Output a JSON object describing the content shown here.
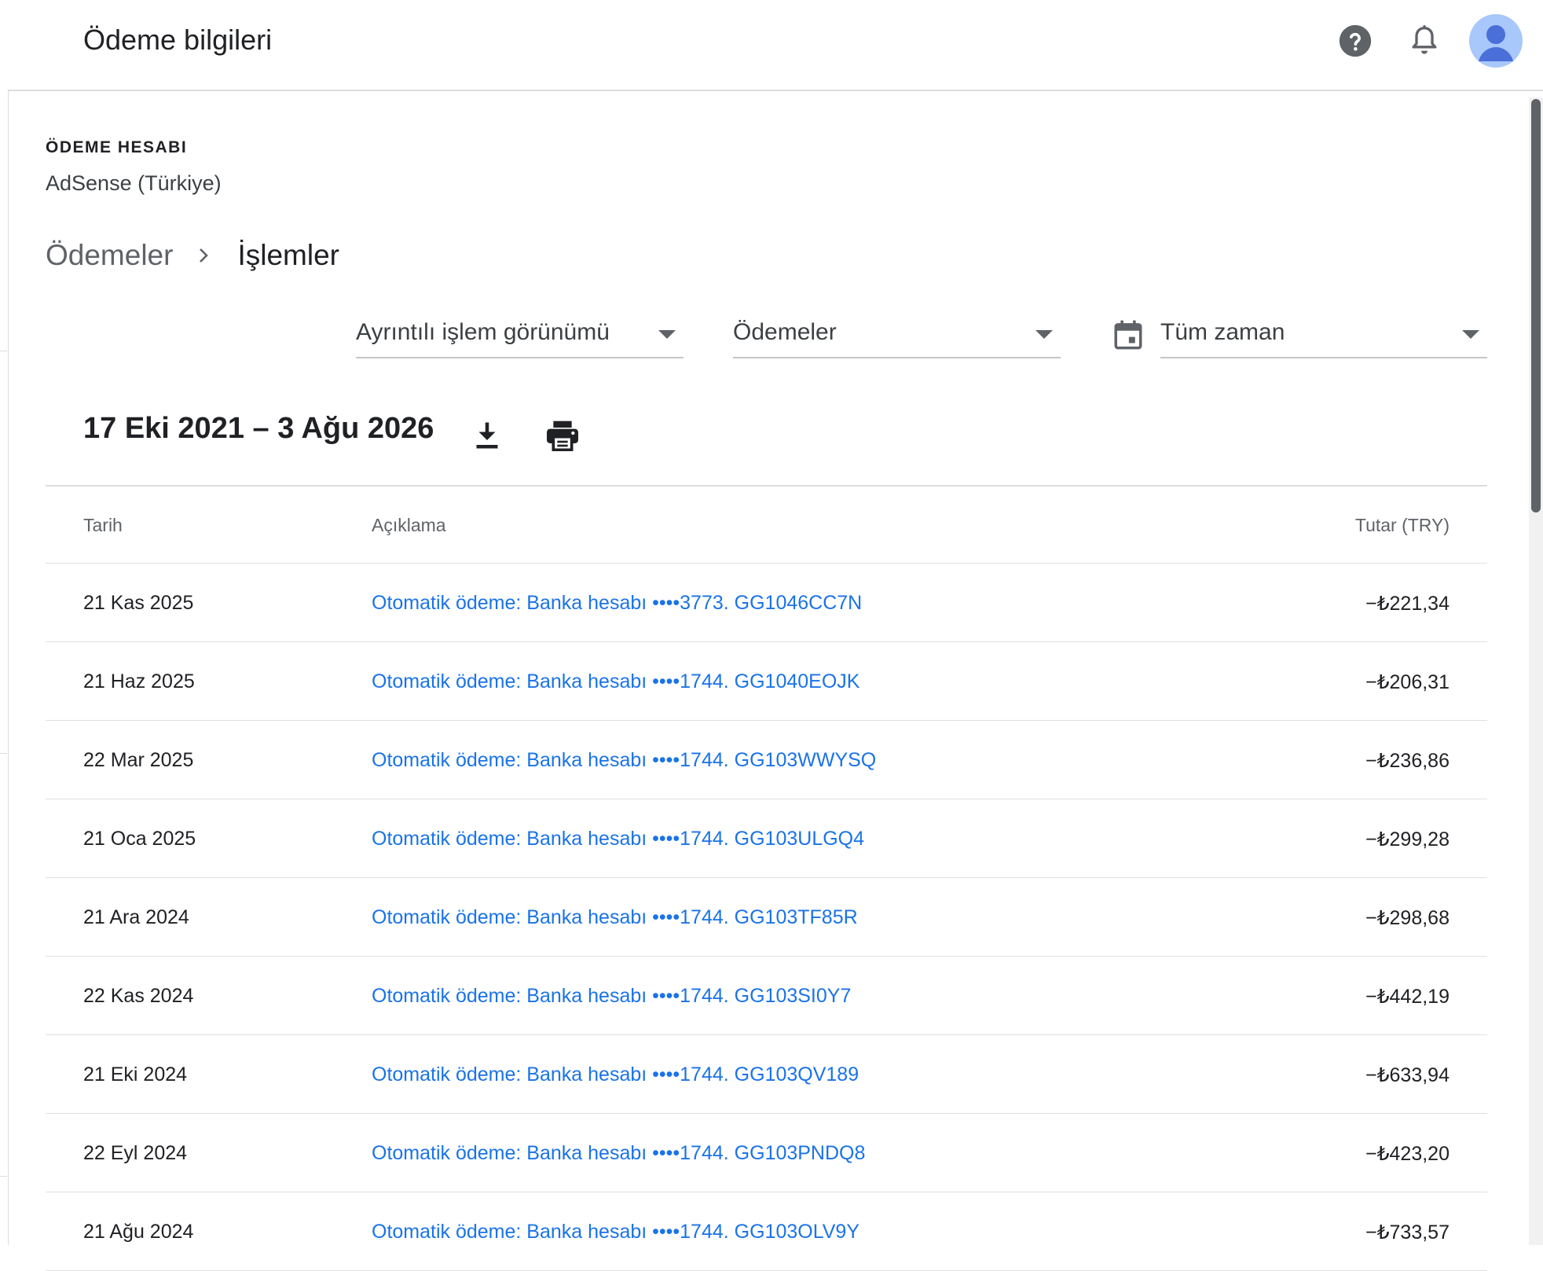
{
  "app_title": "Ödeme bilgileri",
  "header_icons": [
    "help-icon",
    "bell-icon",
    "avatar"
  ],
  "account": {
    "label": "ÖDEME HESABI",
    "name": "AdSense (Türkiye)"
  },
  "breadcrumb": {
    "parent": "Ödemeler",
    "current": "İşlemler"
  },
  "filters": {
    "view": "Ayrıntılı işlem görünümü",
    "type": "Ödemeler",
    "period": "Tüm zaman"
  },
  "date_range": "17 Eki 2021 – 3 Ağu 2026",
  "table": {
    "headers": {
      "date": "Tarih",
      "description": "Açıklama",
      "amount": "Tutar (TRY)"
    },
    "rows": [
      {
        "date": "21 Kas 2025",
        "description": "Otomatik ödeme: Banka hesabı  ••••3773. GG1046CC7N",
        "amount": "−₺221,34"
      },
      {
        "date": "21 Haz 2025",
        "description": "Otomatik ödeme: Banka hesabı  ••••1744. GG1040EOJK",
        "amount": "−₺206,31"
      },
      {
        "date": "22 Mar 2025",
        "description": "Otomatik ödeme: Banka hesabı  ••••1744. GG103WWYSQ",
        "amount": "−₺236,86"
      },
      {
        "date": "21 Oca 2025",
        "description": "Otomatik ödeme: Banka hesabı  ••••1744. GG103ULGQ4",
        "amount": "−₺299,28"
      },
      {
        "date": "21 Ara 2024",
        "description": "Otomatik ödeme: Banka hesabı  ••••1744. GG103TF85R",
        "amount": "−₺298,68"
      },
      {
        "date": "22 Kas 2024",
        "description": "Otomatik ödeme: Banka hesabı  ••••1744. GG103SI0Y7",
        "amount": "−₺442,19"
      },
      {
        "date": "21 Eki 2024",
        "description": "Otomatik ödeme: Banka hesabı  ••••1744. GG103QV189",
        "amount": "−₺633,94"
      },
      {
        "date": "22 Eyl 2024",
        "description": "Otomatik ödeme: Banka hesabı  ••••1744. GG103PNDQ8",
        "amount": "−₺423,20"
      },
      {
        "date": "21 Ağu 2024",
        "description": "Otomatik ödeme: Banka hesabı  ••••1744. GG103OLV9Y",
        "amount": "−₺733,57"
      }
    ]
  },
  "colors": {
    "link": "#1a73e8",
    "text": "#202124",
    "muted": "#5f6368",
    "avatar": "#a8c7fa"
  }
}
